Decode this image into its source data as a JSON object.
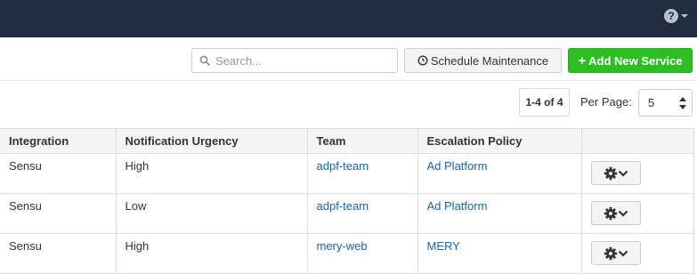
{
  "toolbar": {
    "search_placeholder": "Search...",
    "maintenance_label": "Schedule Maintenance",
    "add_label": "Add New Service"
  },
  "pager": {
    "count": "1-4 of 4",
    "per_page_label": "Per Page:",
    "per_page_value": "5"
  },
  "table": {
    "headers": [
      "Integration",
      "Notification Urgency",
      "Team",
      "Escalation Policy",
      ""
    ],
    "rows": [
      {
        "integration": "Sensu",
        "urgency": "High",
        "team": "adpf-team",
        "policy": "Ad Platform"
      },
      {
        "integration": "Sensu",
        "urgency": "Low",
        "team": "adpf-team",
        "policy": "Ad Platform"
      },
      {
        "integration": "Sensu",
        "urgency": "High",
        "team": "mery-web",
        "policy": "MERY"
      }
    ]
  },
  "colors": {
    "topbar": "#212c40",
    "add_button": "#2dbe23",
    "link": "#1d62a8"
  }
}
